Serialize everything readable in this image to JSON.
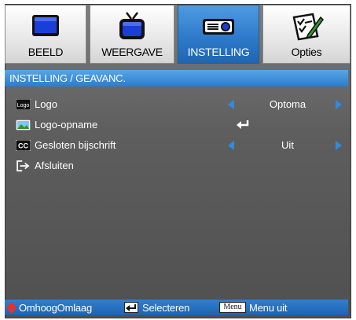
{
  "tabs": [
    {
      "label": "BEELD",
      "icon": "monitor-icon",
      "active": false
    },
    {
      "label": "WEERGAVE",
      "icon": "tv-icon",
      "active": false
    },
    {
      "label": "INSTELLING",
      "icon": "projector-icon",
      "active": true
    },
    {
      "label": "Opties",
      "icon": "checklist-icon",
      "active": false
    }
  ],
  "breadcrumb": "INSTELLING / GEAVANC.",
  "rows": [
    {
      "label": "Logo",
      "value": "Optoma",
      "icon": "logo-icon",
      "badge": "Logo"
    },
    {
      "label": "Logo-opname",
      "value": "",
      "icon": "image-capture-icon"
    },
    {
      "label": "Gesloten bijschrift",
      "value": "Uit",
      "icon": "cc-icon",
      "badge": "CC"
    },
    {
      "label": "Afsluiten",
      "value": "",
      "icon": "exit-icon"
    }
  ],
  "footer": {
    "updown_label": "OmhoogOmlaag",
    "select_label": "Selecteren",
    "menu_key": "Menu",
    "menu_label": "Menu uit"
  },
  "colors": {
    "accent": "#2c78c8",
    "arrow": "#2f8ae0",
    "updown": "#e8312a"
  }
}
